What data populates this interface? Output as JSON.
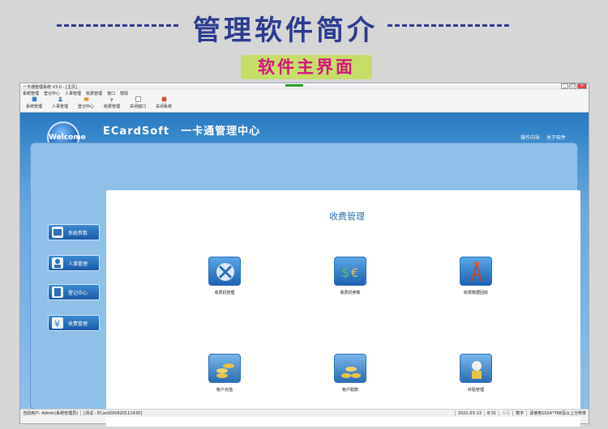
{
  "header": {
    "title": "管理软件简介",
    "subtitle": "软件主界面"
  },
  "window": {
    "titlebar_text": "一卡通管理系统 V3.0 - [主页]",
    "menu": [
      "系统管理",
      "登记中心",
      "人事管理",
      "收费管理",
      "窗口",
      "帮助"
    ],
    "toolbar": [
      {
        "label": "系统管理",
        "icon": "system-icon"
      },
      {
        "label": "人事管理",
        "icon": "person-icon"
      },
      {
        "label": "登记中心",
        "icon": "register-icon"
      },
      {
        "label": "收费管理",
        "icon": "fee-icon"
      },
      {
        "label": "关闭窗口",
        "icon": "close-window-icon"
      },
      {
        "label": "关闭系统",
        "icon": "shutdown-icon"
      }
    ],
    "brand_badge": "Welcome",
    "brand": "ECardSoft　一卡通管理中心",
    "toplinks": [
      "操作向导",
      "关于软件"
    ],
    "content_title": "收费管理",
    "nav": [
      {
        "label": "系统参数",
        "icon": "system-params-icon"
      },
      {
        "label": "人事管理",
        "icon": "user-icon"
      },
      {
        "label": "登记中心",
        "icon": "register-icon"
      },
      {
        "label": "收费管理",
        "icon": "yen-icon"
      }
    ],
    "features": [
      {
        "label": "收费机管理",
        "icon": "tools-icon"
      },
      {
        "label": "收费机参数",
        "icon": "currency-icon"
      },
      {
        "label": "收费数据回收",
        "icon": "antenna-icon"
      },
      {
        "label": "帐户充值",
        "icon": "coins-icon"
      },
      {
        "label": "帐户取款",
        "icon": "gold-coins-icon"
      },
      {
        "label": "补贴管理",
        "icon": "subsidy-icon"
      }
    ],
    "status": {
      "user": "当前用户: Admin(系统管理员)",
      "mode": "[测试 - ECard200820111430]",
      "date": "2021-03-13",
      "time": "8:31",
      "caps": "大写",
      "num": "数字",
      "hint": "请使用1024*768及以上分辨率"
    },
    "colors": {
      "banner_title": "#2d3b8f",
      "subtitle_bg": "#c7dd6a",
      "subtitle_text": "#d4137e",
      "main_blue": "#2a7ac2"
    }
  }
}
